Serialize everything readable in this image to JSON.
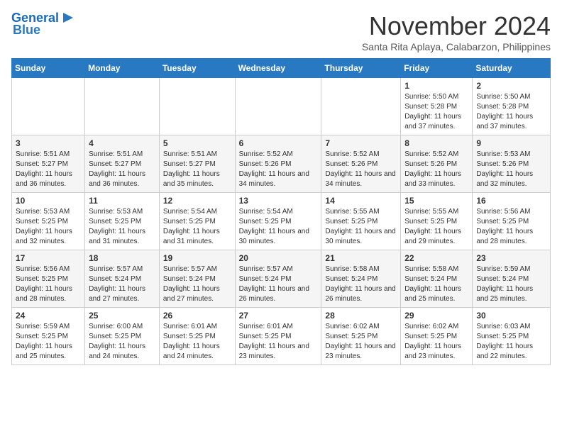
{
  "header": {
    "logo_line1": "General",
    "logo_line2": "Blue",
    "month": "November 2024",
    "location": "Santa Rita Aplaya, Calabarzon, Philippines"
  },
  "days_of_week": [
    "Sunday",
    "Monday",
    "Tuesday",
    "Wednesday",
    "Thursday",
    "Friday",
    "Saturday"
  ],
  "weeks": [
    [
      {
        "day": "",
        "info": ""
      },
      {
        "day": "",
        "info": ""
      },
      {
        "day": "",
        "info": ""
      },
      {
        "day": "",
        "info": ""
      },
      {
        "day": "",
        "info": ""
      },
      {
        "day": "1",
        "info": "Sunrise: 5:50 AM\nSunset: 5:28 PM\nDaylight: 11 hours\nand 37 minutes."
      },
      {
        "day": "2",
        "info": "Sunrise: 5:50 AM\nSunset: 5:28 PM\nDaylight: 11 hours\nand 37 minutes."
      }
    ],
    [
      {
        "day": "3",
        "info": "Sunrise: 5:51 AM\nSunset: 5:27 PM\nDaylight: 11 hours\nand 36 minutes."
      },
      {
        "day": "4",
        "info": "Sunrise: 5:51 AM\nSunset: 5:27 PM\nDaylight: 11 hours\nand 36 minutes."
      },
      {
        "day": "5",
        "info": "Sunrise: 5:51 AM\nSunset: 5:27 PM\nDaylight: 11 hours\nand 35 minutes."
      },
      {
        "day": "6",
        "info": "Sunrise: 5:52 AM\nSunset: 5:26 PM\nDaylight: 11 hours\nand 34 minutes."
      },
      {
        "day": "7",
        "info": "Sunrise: 5:52 AM\nSunset: 5:26 PM\nDaylight: 11 hours\nand 34 minutes."
      },
      {
        "day": "8",
        "info": "Sunrise: 5:52 AM\nSunset: 5:26 PM\nDaylight: 11 hours\nand 33 minutes."
      },
      {
        "day": "9",
        "info": "Sunrise: 5:53 AM\nSunset: 5:26 PM\nDaylight: 11 hours\nand 32 minutes."
      }
    ],
    [
      {
        "day": "10",
        "info": "Sunrise: 5:53 AM\nSunset: 5:25 PM\nDaylight: 11 hours\nand 32 minutes."
      },
      {
        "day": "11",
        "info": "Sunrise: 5:53 AM\nSunset: 5:25 PM\nDaylight: 11 hours\nand 31 minutes."
      },
      {
        "day": "12",
        "info": "Sunrise: 5:54 AM\nSunset: 5:25 PM\nDaylight: 11 hours\nand 31 minutes."
      },
      {
        "day": "13",
        "info": "Sunrise: 5:54 AM\nSunset: 5:25 PM\nDaylight: 11 hours\nand 30 minutes."
      },
      {
        "day": "14",
        "info": "Sunrise: 5:55 AM\nSunset: 5:25 PM\nDaylight: 11 hours\nand 30 minutes."
      },
      {
        "day": "15",
        "info": "Sunrise: 5:55 AM\nSunset: 5:25 PM\nDaylight: 11 hours\nand 29 minutes."
      },
      {
        "day": "16",
        "info": "Sunrise: 5:56 AM\nSunset: 5:25 PM\nDaylight: 11 hours\nand 28 minutes."
      }
    ],
    [
      {
        "day": "17",
        "info": "Sunrise: 5:56 AM\nSunset: 5:25 PM\nDaylight: 11 hours\nand 28 minutes."
      },
      {
        "day": "18",
        "info": "Sunrise: 5:57 AM\nSunset: 5:24 PM\nDaylight: 11 hours\nand 27 minutes."
      },
      {
        "day": "19",
        "info": "Sunrise: 5:57 AM\nSunset: 5:24 PM\nDaylight: 11 hours\nand 27 minutes."
      },
      {
        "day": "20",
        "info": "Sunrise: 5:57 AM\nSunset: 5:24 PM\nDaylight: 11 hours\nand 26 minutes."
      },
      {
        "day": "21",
        "info": "Sunrise: 5:58 AM\nSunset: 5:24 PM\nDaylight: 11 hours\nand 26 minutes."
      },
      {
        "day": "22",
        "info": "Sunrise: 5:58 AM\nSunset: 5:24 PM\nDaylight: 11 hours\nand 25 minutes."
      },
      {
        "day": "23",
        "info": "Sunrise: 5:59 AM\nSunset: 5:24 PM\nDaylight: 11 hours\nand 25 minutes."
      }
    ],
    [
      {
        "day": "24",
        "info": "Sunrise: 5:59 AM\nSunset: 5:25 PM\nDaylight: 11 hours\nand 25 minutes."
      },
      {
        "day": "25",
        "info": "Sunrise: 6:00 AM\nSunset: 5:25 PM\nDaylight: 11 hours\nand 24 minutes."
      },
      {
        "day": "26",
        "info": "Sunrise: 6:01 AM\nSunset: 5:25 PM\nDaylight: 11 hours\nand 24 minutes."
      },
      {
        "day": "27",
        "info": "Sunrise: 6:01 AM\nSunset: 5:25 PM\nDaylight: 11 hours\nand 23 minutes."
      },
      {
        "day": "28",
        "info": "Sunrise: 6:02 AM\nSunset: 5:25 PM\nDaylight: 11 hours\nand 23 minutes."
      },
      {
        "day": "29",
        "info": "Sunrise: 6:02 AM\nSunset: 5:25 PM\nDaylight: 11 hours\nand 23 minutes."
      },
      {
        "day": "30",
        "info": "Sunrise: 6:03 AM\nSunset: 5:25 PM\nDaylight: 11 hours\nand 22 minutes."
      }
    ]
  ]
}
